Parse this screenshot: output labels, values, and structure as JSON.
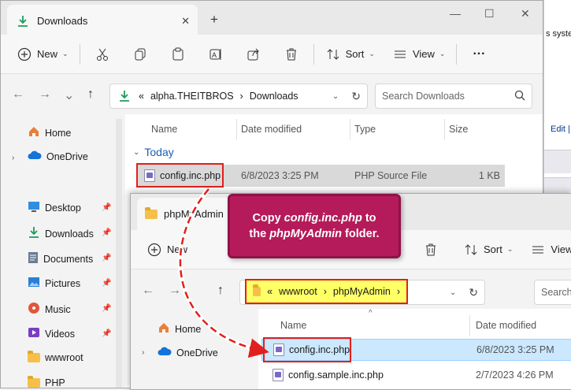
{
  "background": {
    "partial_text": "s syste",
    "partial_link": "Edit |"
  },
  "window1": {
    "tab_title": "Downloads",
    "toolbar": {
      "new_label": "New",
      "sort_label": "Sort",
      "view_label": "View",
      "more_label": "···"
    },
    "breadcrumb": {
      "prefix": "«",
      "root": "alpha.THEITBROS",
      "sep": "›",
      "current": "Downloads"
    },
    "search_placeholder": "Search Downloads",
    "nav_items": [
      {
        "label": "Home"
      },
      {
        "label": "OneDrive"
      },
      {
        "label": "Desktop"
      },
      {
        "label": "Downloads"
      },
      {
        "label": "Documents"
      },
      {
        "label": "Pictures"
      },
      {
        "label": "Music"
      },
      {
        "label": "Videos"
      },
      {
        "label": "wwwroot"
      },
      {
        "label": "PHP"
      }
    ],
    "columns": {
      "name": "Name",
      "date": "Date modified",
      "type": "Type",
      "size": "Size"
    },
    "group_label": "Today",
    "file": {
      "name": "config.inc.php",
      "date": "6/8/2023 3:25 PM",
      "type": "PHP Source File",
      "size": "1 KB"
    }
  },
  "window2": {
    "tab_title": "phpMyAdmin",
    "toolbar": {
      "new_label": "New",
      "sort_label": "Sort",
      "view_label": "View"
    },
    "breadcrumb": {
      "prefix": "«",
      "root": "wwwroot",
      "sep": "›",
      "current": "phpMyAdmin"
    },
    "search_placeholder": "Search",
    "nav_items": [
      {
        "label": "Home"
      },
      {
        "label": "OneDrive"
      }
    ],
    "columns": {
      "name": "Name",
      "date": "Date modified"
    },
    "files": [
      {
        "name": "config.inc.php",
        "date": "6/8/2023 3:25 PM"
      },
      {
        "name": "config.sample.inc.php",
        "date": "2/7/2023 4:26 PM"
      }
    ]
  },
  "callout": {
    "line1_pre": "Copy ",
    "line1_em": "config.inc.php",
    "line1_post": " to",
    "line2_pre": "the ",
    "line2_em": "phpMyAdmin",
    "line2_post": " folder."
  },
  "colors": {
    "accent": "#b51b5a",
    "highlight_red": "#e0201c",
    "highlight_yellow": "#ffff66",
    "selection": "#cce8ff"
  }
}
